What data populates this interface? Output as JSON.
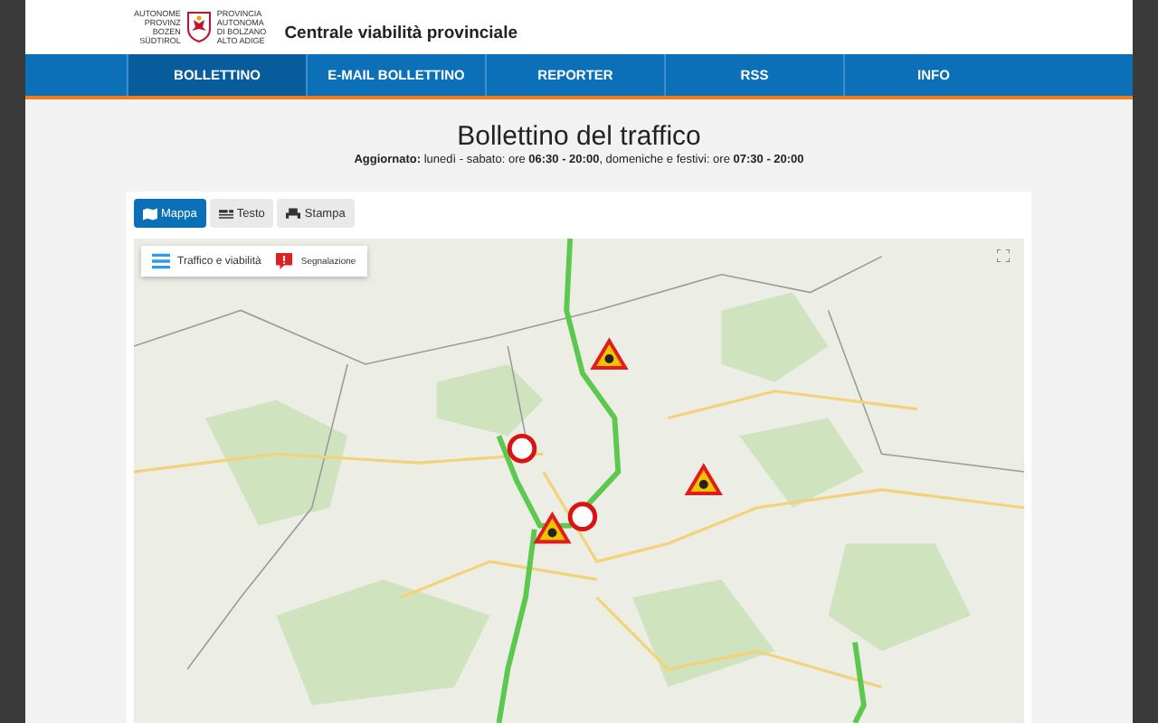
{
  "header": {
    "logo_left": [
      "AUTONOME",
      "PROVINZ",
      "BOZEN",
      "SÜDTIROL"
    ],
    "logo_right": [
      "PROVINCIA",
      "AUTONOMA",
      "DI BOLZANO",
      "ALTO ADIGE"
    ],
    "title": "Centrale viabilità provinciale"
  },
  "nav": [
    {
      "label": "BOLLETTINO",
      "selected": true
    },
    {
      "label": "E-MAIL BOLLETTINO",
      "selected": false
    },
    {
      "label": "REPORTER",
      "selected": false
    },
    {
      "label": "RSS",
      "selected": false
    },
    {
      "label": "INFO",
      "selected": false
    }
  ],
  "page_title": "Bollettino del traffico",
  "updated": "**Aggiornato:** lunedì - sabato: ore **06:30 - 20:00**, domeniche e festivi: ore **07:30 - 20:00**",
  "view_tabs": [
    {
      "kind": "map",
      "label": "Mappa",
      "selected": true
    },
    {
      "kind": "text",
      "label": "Testo",
      "selected": false
    },
    {
      "kind": "print",
      "label": "Stampa",
      "selected": false
    }
  ],
  "map": {
    "layers_button": "Traffico e viabilità",
    "report_button": "Segnalazione"
  }
}
